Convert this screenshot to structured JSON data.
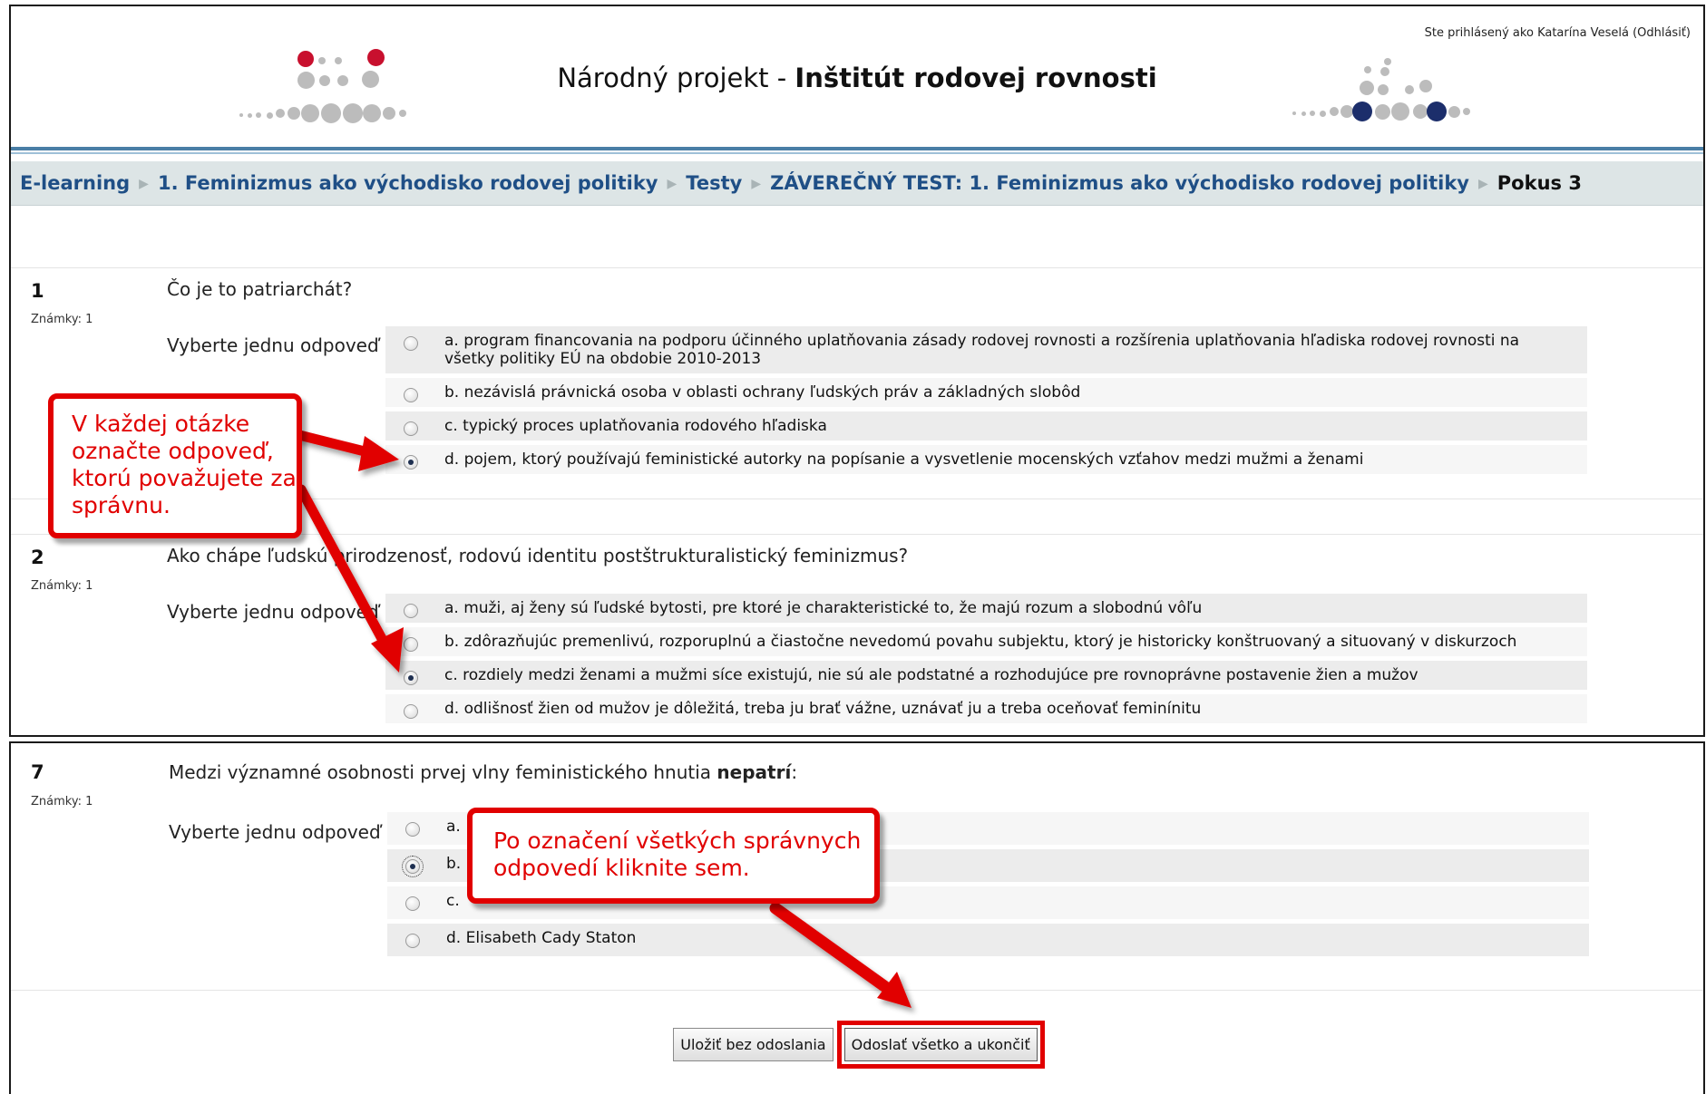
{
  "header": {
    "login_prefix": "Ste prihlásený ako ",
    "user_name": "Katarína Veselá",
    "logout_label": "(Odhlásiť)",
    "title_prefix": "Národný projekt - ",
    "title_bold": "Inštitút rodovej rovnosti"
  },
  "breadcrumb": [
    "E-learning",
    "1. Feminizmus ako východisko rodovej politiky",
    "Testy",
    "ZÁVEREČNÝ TEST: 1. Feminizmus ako východisko rodovej politiky",
    "Pokus 3"
  ],
  "questions": [
    {
      "number": "1",
      "marks": "Známky: 1",
      "text": "Čo je to patriarchát?",
      "prompt": "Vyberte jednu odpoveď",
      "answers": [
        {
          "label": "a. program financovania na podporu účinného uplatňovania zásady rodovej rovnosti a rozšírenia uplatňovania hľadiska rodovej rovnosti na všetky politiky EÚ na obdobie 2010-2013",
          "selected": false
        },
        {
          "label": "b. nezávislá právnická osoba v oblasti ochrany ľudských práv a základných slobôd",
          "selected": false
        },
        {
          "label": "c. typický proces uplatňovania rodového hľadiska",
          "selected": false
        },
        {
          "label": "d. pojem, ktorý používajú feministické autorky na popísanie a vysvetlenie mocenských vzťahov medzi mužmi a ženami",
          "selected": true
        }
      ]
    },
    {
      "number": "2",
      "marks": "Známky: 1",
      "text": "Ako chápe ľudskú prirodzenosť, rodovú identitu postštrukturalistický feminizmus?",
      "prompt": "Vyberte jednu odpoveď",
      "answers": [
        {
          "label": "a. muži, aj ženy sú ľudské bytosti, pre ktoré je charakteristické to, že majú rozum a slobodnú vôľu",
          "selected": false
        },
        {
          "label": "b. zdôrazňujúc premenlivú, rozporuplnú a čiastočne nevedomú povahu subjektu, ktorý je historicky konštruovaný a situovaný v diskurzoch",
          "selected": false
        },
        {
          "label": "c. rozdiely medzi ženami a mužmi síce existujú, nie sú ale podstatné a rozhodujúce pre rovnoprávne postavenie žien a mužov",
          "selected": true
        },
        {
          "label": "d. odlišnosť žien od mužov je dôležitá, treba ju brať vážne, uznávať ju a treba oceňovať feminínitu",
          "selected": false
        }
      ]
    },
    {
      "number": "7",
      "marks": "Známky: 1",
      "text_before": "Medzi významné osobnosti prvej vlny feministického hnutia ",
      "text_bold": "nepatrí",
      "text_after": ":",
      "prompt": "Vyberte jednu odpoveď",
      "answers": [
        {
          "label": "a.",
          "selected": false
        },
        {
          "label": "b.",
          "selected": true
        },
        {
          "label": "c.",
          "selected": false
        },
        {
          "label": "d. Elisabeth Cady Staton",
          "selected": false
        }
      ]
    }
  ],
  "buttons": {
    "save_without_submit": "Uložiť bez odoslania",
    "submit_all": "Odoslať všetko a ukončiť"
  },
  "callouts": {
    "select_answer": "V každej otázke označte odpoveď, ktorú považujete za správnu.",
    "click_here": "Po označení všetkých správnych odpovedí kliknite sem."
  },
  "colors": {
    "logo_red": "#c8102e",
    "logo_navy": "#1c2e6b",
    "logo_grey": "#bcbcbc",
    "link_blue": "#1f4f86",
    "callout_red": "#e10000"
  }
}
